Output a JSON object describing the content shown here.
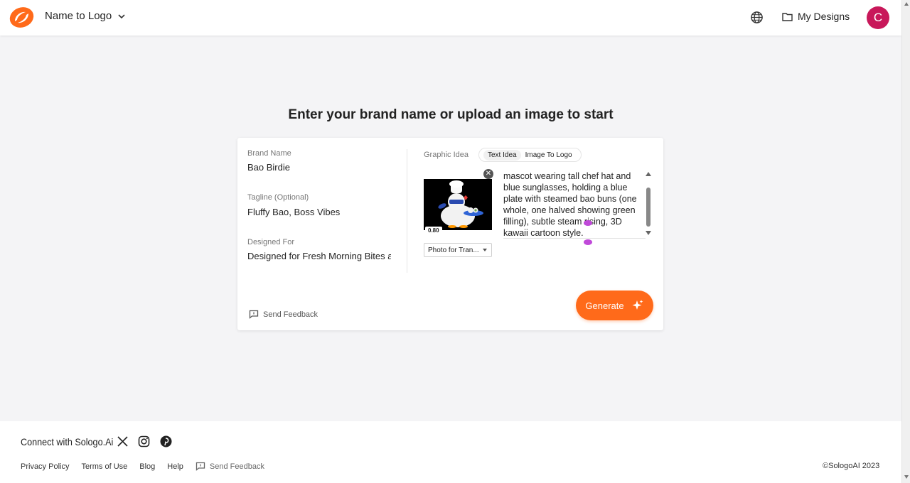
{
  "header": {
    "app_title": "Name to Logo",
    "my_designs": "My Designs",
    "avatar_initial": "C"
  },
  "main": {
    "heading": "Enter your brand name or upload an image to start"
  },
  "form": {
    "brand_name_label": "Brand Name",
    "brand_name_value": "Bao Birdie",
    "tagline_label": "Tagline (Optional)",
    "tagline_value": "Fluffy Bao, Boss Vibes",
    "designed_for_label": "Designed For",
    "designed_for_value": "Designed for Fresh Morning Bites a",
    "graphic_idea_label": "Graphic Idea",
    "tabs": [
      "Text Idea",
      "Image To Logo"
    ],
    "active_tab": "Text Idea",
    "image_score": "0.80",
    "idea_text": "mascot wearing tall chef hat and blue sunglasses, holding a blue plate with steamed bao buns (one whole, one halved showing green filling), subtle steam rising, 3D kawaii cartoon style.",
    "photo_mode": "Photo for Tran...",
    "send_feedback": "Send Feedback",
    "generate_label": "Generate"
  },
  "footer": {
    "connect": "Connect with Sologo.Ai",
    "links": [
      "Privacy Policy",
      "Terms of Use",
      "Blog",
      "Help"
    ],
    "send_feedback": "Send Feedback",
    "copyright": "©SologoAI 2023"
  },
  "colors": {
    "brand_orange": "#ff6a1a",
    "avatar_bg": "#c8185a",
    "background": "#f4f4f6"
  }
}
